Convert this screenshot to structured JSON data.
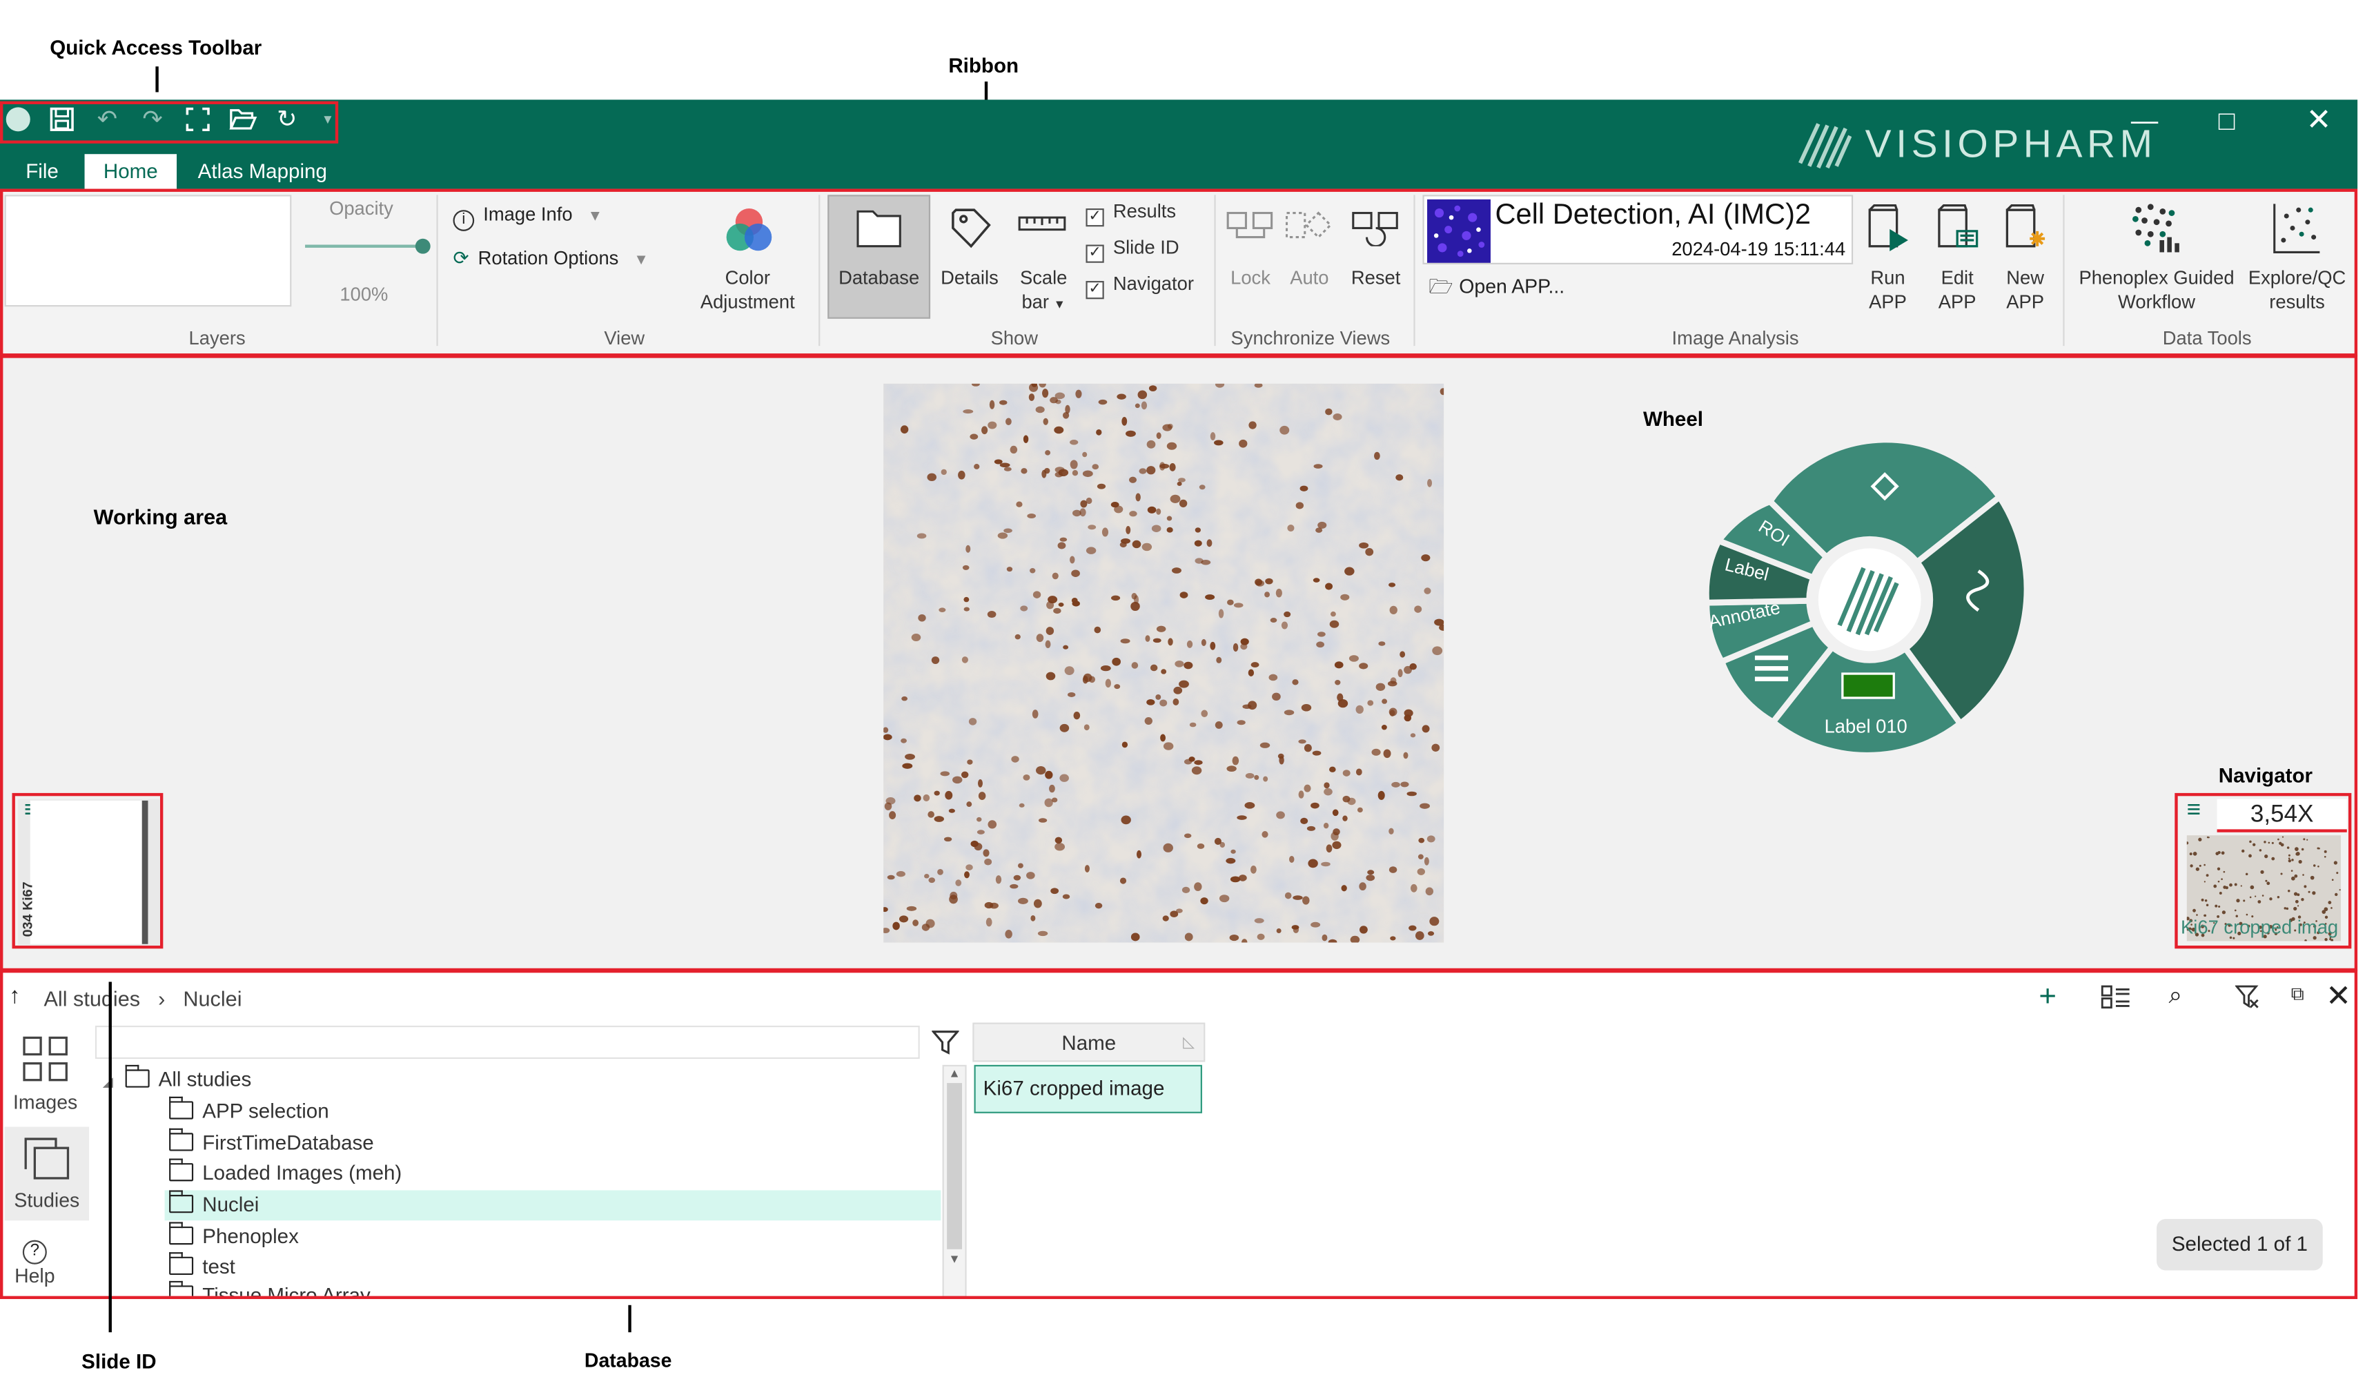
{
  "callouts": {
    "quick_access": "Quick Access Toolbar",
    "ribbon": "Ribbon",
    "working_area": "Working area",
    "wheel": "Wheel",
    "navigator": "Navigator",
    "slide_id": "Slide ID",
    "database": "Database"
  },
  "colors": {
    "brand": "#056a55",
    "wheel": "#3d8a78",
    "wheel_dark": "#2c6755",
    "callout_box": "#e4202c",
    "selection": "#d6f7ef"
  },
  "app": {
    "logo_text": "VISIOPHARM",
    "window_controls": [
      "minimize",
      "maximize",
      "close"
    ]
  },
  "quick_access": {
    "icons": [
      "app-icon",
      "save-icon",
      "undo-icon",
      "redo-icon",
      "fullscreen-icon",
      "open-icon",
      "refresh-icon",
      "dropdown-icon"
    ]
  },
  "menu": {
    "tabs": [
      {
        "label": "File"
      },
      {
        "label": "Home",
        "active": true
      },
      {
        "label": "Atlas Mapping"
      }
    ]
  },
  "ribbon": {
    "layers": {
      "group": "Layers",
      "opacity_label": "Opacity",
      "opacity_value": "100%",
      "opacity": 1.0
    },
    "view": {
      "group": "View",
      "image_info": "Image Info",
      "rotation": "Rotation Options",
      "color_adj_1": "Color",
      "color_adj_2": "Adjustment"
    },
    "show": {
      "group": "Show",
      "database": "Database",
      "details": "Details",
      "scale_1": "Scale",
      "scale_2": "bar",
      "checks": [
        {
          "label": "Results",
          "checked": true
        },
        {
          "label": "Slide ID",
          "checked": true
        },
        {
          "label": "Navigator",
          "checked": true
        }
      ]
    },
    "sync": {
      "group": "Synchronize Views",
      "lock": "Lock",
      "auto": "Auto",
      "reset": "Reset"
    },
    "analysis": {
      "group": "Image Analysis",
      "app_name": "Cell Detection, AI (IMC)2",
      "app_date": "2024-04-19 15:11:44",
      "open_app": "Open APP...",
      "run_1": "Run",
      "run_2": "APP",
      "edit_1": "Edit",
      "edit_2": "APP",
      "new_1": "New",
      "new_2": "APP"
    },
    "data_tools": {
      "group": "Data Tools",
      "phenoplex_1": "Phenoplex Guided",
      "phenoplex_2": "Workflow",
      "explore_1": "Explore/QC",
      "explore_2": "results"
    }
  },
  "wheel": {
    "roi": "ROI",
    "label": "Label",
    "annotate": "Annotate",
    "label_item": "Label 010"
  },
  "slide_id": {
    "text": "034 Ki67"
  },
  "navigator": {
    "zoom": "3,54X",
    "image_name": "Ki67 cropped imag"
  },
  "database": {
    "breadcrumb": [
      "All studies",
      "Nuclei"
    ],
    "side_tabs": [
      "Images",
      "Studies",
      "Help"
    ],
    "tree_root": "All studies",
    "tree_items": [
      "APP selection",
      "FirstTimeDatabase",
      "Loaded Images (meh)",
      "Nuclei",
      "Phenoplex",
      "test",
      "Tissue Micro Array"
    ],
    "selected_item": "Nuclei",
    "column_header": "Name",
    "rows": [
      "Ki67 cropped image"
    ],
    "selected_status": "Selected 1 of 1"
  }
}
